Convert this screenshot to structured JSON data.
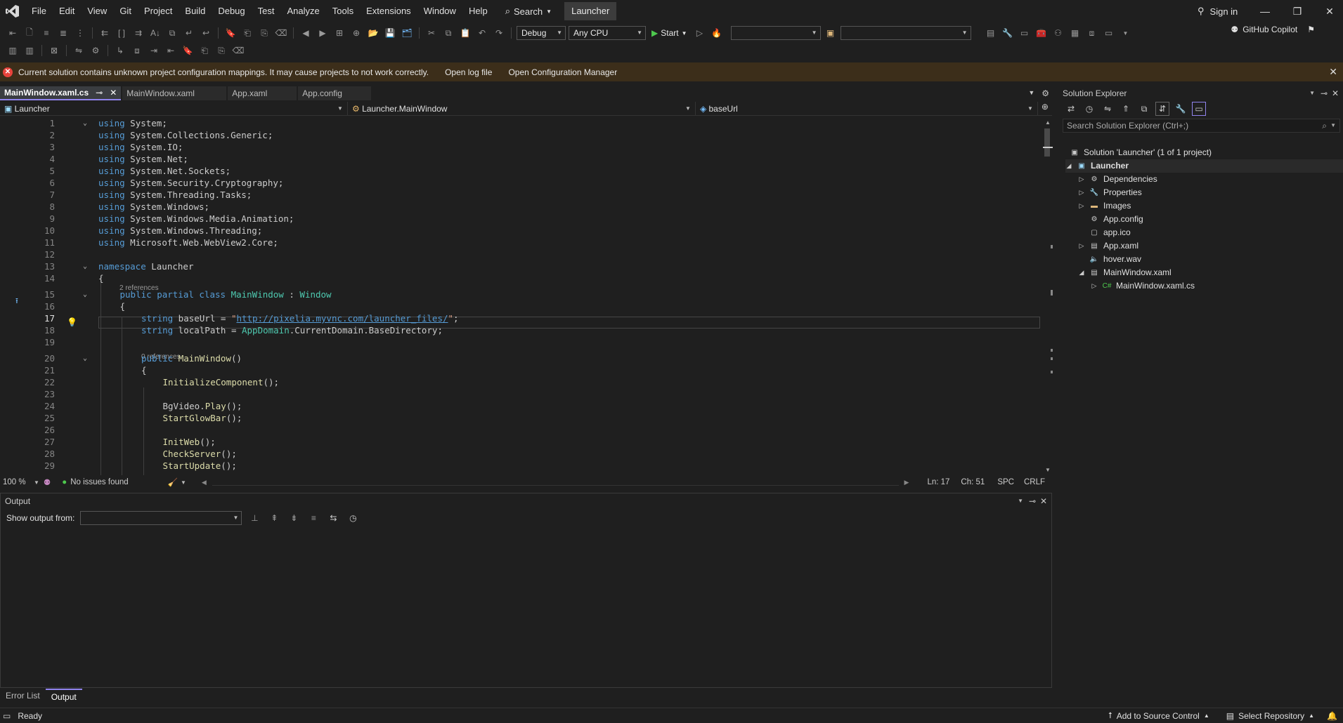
{
  "menu": [
    "File",
    "Edit",
    "View",
    "Git",
    "Project",
    "Build",
    "Debug",
    "Test",
    "Analyze",
    "Tools",
    "Extensions",
    "Window",
    "Help"
  ],
  "search_label": "Search",
  "solution_badge": "Launcher",
  "sign_in": "Sign in",
  "toolbar": {
    "config": "Debug",
    "platform": "Any CPU",
    "start": "Start",
    "copilot": "GitHub Copilot"
  },
  "infobar": {
    "message": "Current solution contains unknown project configuration mappings. It may cause projects to not work correctly.",
    "open_log": "Open log file",
    "open_config": "Open Configuration Manager"
  },
  "tabs": [
    "MainWindow.xaml.cs",
    "MainWindow.xaml",
    "App.xaml",
    "App.config"
  ],
  "nav": {
    "project": "Launcher",
    "type": "Launcher.MainWindow",
    "member": "baseUrl"
  },
  "code": [
    {
      "n": "1",
      "t": "using System;"
    },
    {
      "n": "2",
      "t": "using System.Collections.Generic;"
    },
    {
      "n": "3",
      "t": "using System.IO;"
    },
    {
      "n": "4",
      "t": "using System.Net;"
    },
    {
      "n": "5",
      "t": "using System.Net.Sockets;"
    },
    {
      "n": "6",
      "t": "using System.Security.Cryptography;"
    },
    {
      "n": "7",
      "t": "using System.Threading.Tasks;"
    },
    {
      "n": "8",
      "t": "using System.Windows;"
    },
    {
      "n": "9",
      "t": "using System.Windows.Media.Animation;"
    },
    {
      "n": "10",
      "t": "using System.Windows.Threading;"
    },
    {
      "n": "11",
      "t": "using Microsoft.Web.WebView2.Core;"
    },
    {
      "n": "12",
      "t": ""
    },
    {
      "n": "13",
      "t": "namespace Launcher"
    },
    {
      "n": "14",
      "t": "{"
    },
    {
      "n": "15",
      "t": "public partial class MainWindow : Window"
    },
    {
      "n": "16",
      "t": "{"
    },
    {
      "n": "17",
      "t": "string baseUrl = \"http://pixelia.myvnc.com/launcher_files/\";"
    },
    {
      "n": "18",
      "t": "string localPath = AppDomain.CurrentDomain.BaseDirectory;"
    },
    {
      "n": "19",
      "t": ""
    },
    {
      "n": "20",
      "t": "public MainWindow()"
    },
    {
      "n": "21",
      "t": "{"
    },
    {
      "n": "22",
      "t": "InitializeComponent();"
    },
    {
      "n": "23",
      "t": ""
    },
    {
      "n": "24",
      "t": "BgVideo.Play();"
    },
    {
      "n": "25",
      "t": "StartGlowBar();"
    },
    {
      "n": "26",
      "t": ""
    },
    {
      "n": "27",
      "t": "InitWeb();"
    },
    {
      "n": "28",
      "t": "CheckServer();"
    },
    {
      "n": "29",
      "t": "StartUpdate();"
    }
  ],
  "codelens": {
    "class_refs": "2 references",
    "ctor_refs": "0 references"
  },
  "editor_status": {
    "zoom": "100 %",
    "issues": "No issues found",
    "ln": "Ln: 17",
    "ch": "Ch: 51",
    "spc": "SPC",
    "eol": "CRLF"
  },
  "output": {
    "title": "Output",
    "show_from": "Show output from:"
  },
  "bottom_tabs": [
    "Error List",
    "Output"
  ],
  "solution_explorer": {
    "title": "Solution Explorer",
    "search_placeholder": "Search Solution Explorer (Ctrl+;)",
    "nodes": [
      {
        "label": "Solution 'Launcher' (1 of 1 project)",
        "icon": "solution-icon"
      },
      {
        "label": "Launcher",
        "icon": "csharp-project-icon"
      },
      {
        "label": "Dependencies",
        "icon": "dependencies-icon"
      },
      {
        "label": "Properties",
        "icon": "wrench-folder-icon"
      },
      {
        "label": "Images",
        "icon": "folder-icon"
      },
      {
        "label": "App.config",
        "icon": "config-file-icon"
      },
      {
        "label": "app.ico",
        "icon": "icon-file-icon"
      },
      {
        "label": "App.xaml",
        "icon": "xaml-file-icon"
      },
      {
        "label": "hover.wav",
        "icon": "audio-file-icon"
      },
      {
        "label": "MainWindow.xaml",
        "icon": "xaml-file-icon"
      },
      {
        "label": "MainWindow.xaml.cs",
        "icon": "csharp-file-icon"
      }
    ]
  },
  "status": {
    "ready": "Ready",
    "source_control": "Add to Source Control",
    "repo": "Select Repository"
  },
  "colors": {
    "accent": "#9184ee",
    "keyword": "#569cd6",
    "type": "#4ec9b0",
    "string": "#d69d85",
    "infobar": "#3c2e1a"
  }
}
